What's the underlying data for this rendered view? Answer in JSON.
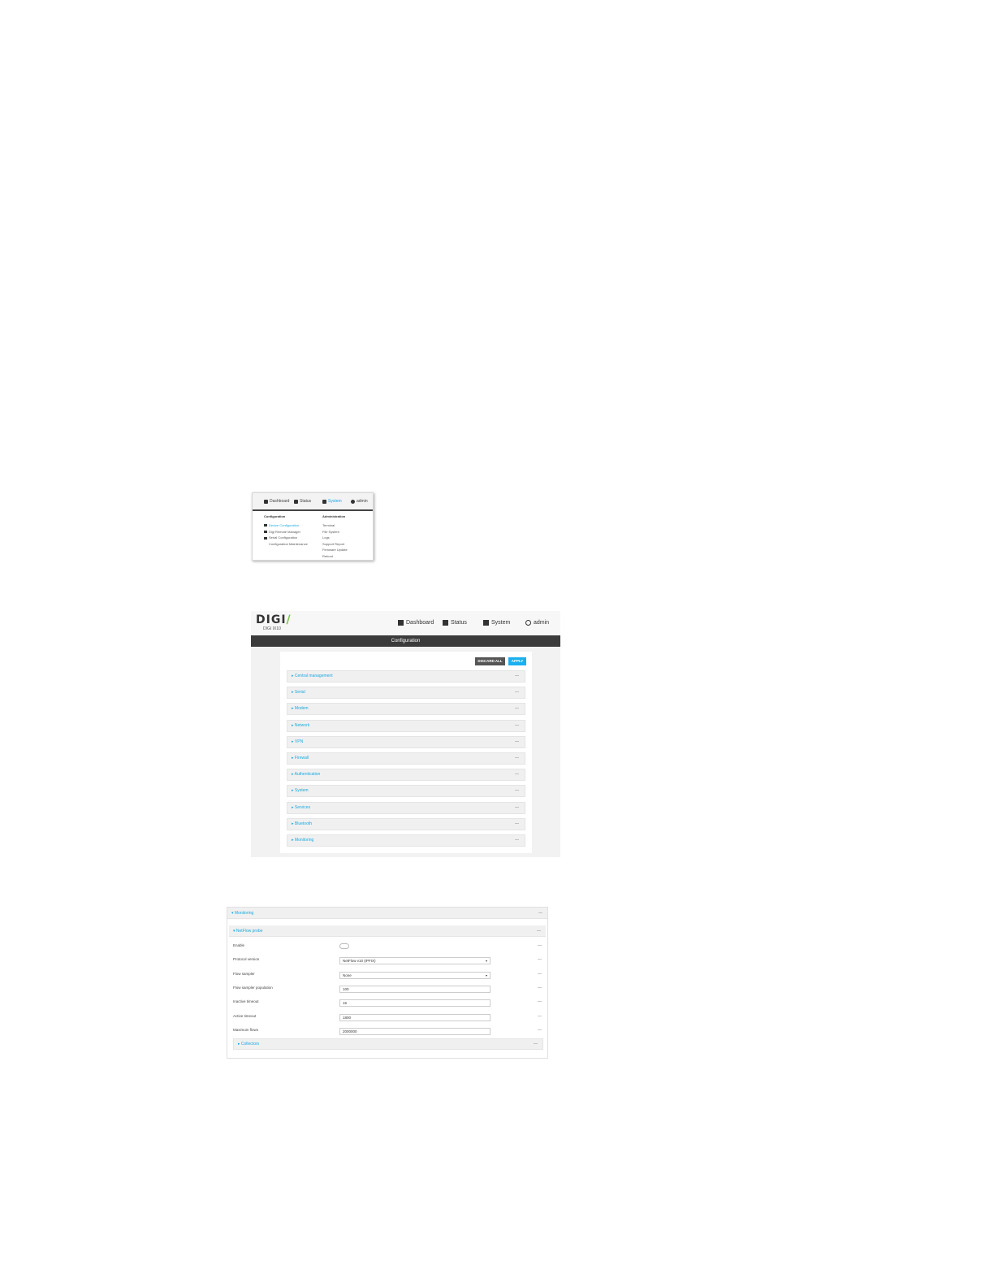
{
  "shot1": {
    "nav": [
      "Dashboard",
      "Status",
      "System",
      "admin"
    ],
    "configuration": {
      "header": "Configuration",
      "items": [
        "Device Configuration",
        "Digi Remote Manager",
        "Serial Configuration",
        "Configuration Maintenance"
      ]
    },
    "administration": {
      "header": "Administration",
      "items": [
        "Terminal",
        "File System",
        "Logs",
        "Support Report",
        "Firmware Update",
        "Reboot"
      ]
    }
  },
  "shot2": {
    "logo": "DIGI",
    "logo_sub": "DIGI IX10",
    "nav": [
      "Dashboard",
      "Status",
      "System",
      "admin"
    ],
    "title": "Configuration",
    "discard_label": "DISCARD ALL",
    "apply_label": "APPLY",
    "sections": [
      "Central management",
      "Serial",
      "Modem",
      "Network",
      "VPN",
      "Firewall",
      "Authentication",
      "System",
      "Services",
      "Bluetooth",
      "Monitoring"
    ],
    "dash": "—"
  },
  "shot3": {
    "monitoring": "Monitoring",
    "netflow": "NetFlow probe",
    "fields": [
      {
        "label": "Enable",
        "type": "toggle",
        "value": ""
      },
      {
        "label": "Protocol version",
        "type": "select",
        "value": "NetFlow v10 (IPFIX)"
      },
      {
        "label": "Flow sampler",
        "type": "select",
        "value": "None"
      },
      {
        "label": "Flow sampler population",
        "type": "input",
        "value": "100"
      },
      {
        "label": "Inactive timeout",
        "type": "input",
        "value": "15"
      },
      {
        "label": "Active timeout",
        "type": "input",
        "value": "1800"
      },
      {
        "label": "Maximum flows",
        "type": "input",
        "value": "2000000"
      }
    ],
    "collectors": "Collectors",
    "dash": "—"
  }
}
